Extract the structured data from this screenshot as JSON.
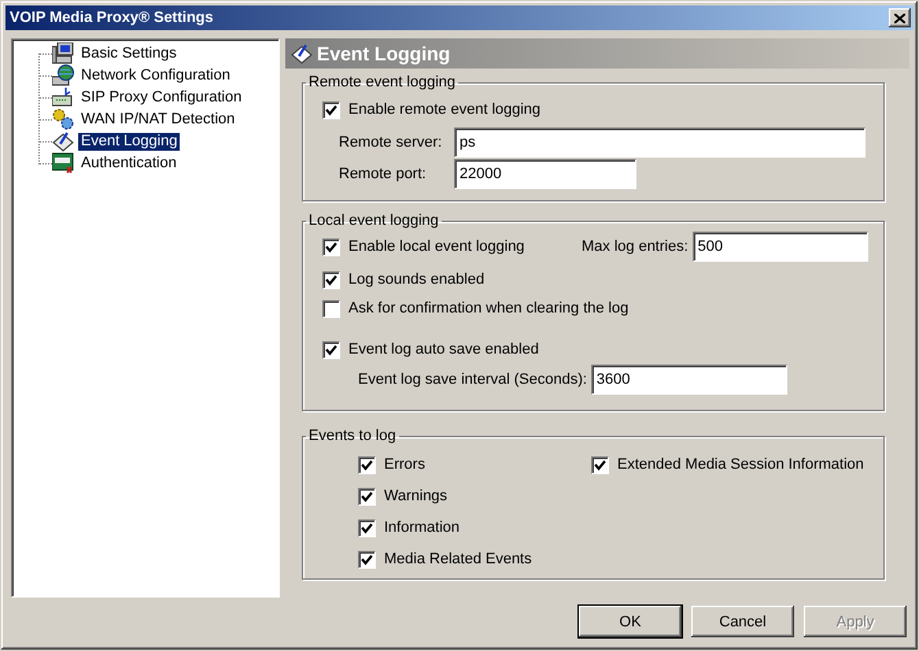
{
  "window": {
    "title": "VOIP Media Proxy® Settings"
  },
  "tree": {
    "items": [
      {
        "label": "Basic Settings",
        "selected": false
      },
      {
        "label": "Network Configuration",
        "selected": false
      },
      {
        "label": "SIP Proxy Configuration",
        "selected": false
      },
      {
        "label": "WAN IP/NAT Detection",
        "selected": false
      },
      {
        "label": "Event Logging",
        "selected": true
      },
      {
        "label": "Authentication",
        "selected": false
      }
    ]
  },
  "panel": {
    "title": "Event Logging"
  },
  "remote": {
    "title": "Remote event logging",
    "enable": {
      "label": "Enable remote event logging",
      "checked": true
    },
    "server": {
      "label": "Remote server:",
      "value": "ps"
    },
    "port": {
      "label": "Remote port:",
      "value": "22000"
    }
  },
  "local": {
    "title": "Local event logging",
    "enable": {
      "label": "Enable local event logging",
      "checked": true
    },
    "max_entries": {
      "label": "Max log entries:",
      "value": "500"
    },
    "sounds": {
      "label": "Log sounds enabled",
      "checked": true
    },
    "confirm": {
      "label": "Ask for confirmation when clearing the log",
      "checked": false
    },
    "auto_save": {
      "label": "Event log auto save enabled",
      "checked": true
    },
    "interval": {
      "label": "Event log save interval (Seconds):",
      "value": "3600"
    }
  },
  "events": {
    "title": "Events to log",
    "items": [
      {
        "label": "Errors",
        "checked": true
      },
      {
        "label": "Warnings",
        "checked": true
      },
      {
        "label": "Information",
        "checked": true
      },
      {
        "label": "Media Related Events",
        "checked": true
      },
      {
        "label": "Extended Media Session Information",
        "checked": true
      }
    ]
  },
  "buttons": [
    {
      "label": "OK",
      "default": true,
      "disabled": false
    },
    {
      "label": "Cancel",
      "default": false,
      "disabled": false
    },
    {
      "label": "Apply",
      "default": false,
      "disabled": true
    }
  ]
}
